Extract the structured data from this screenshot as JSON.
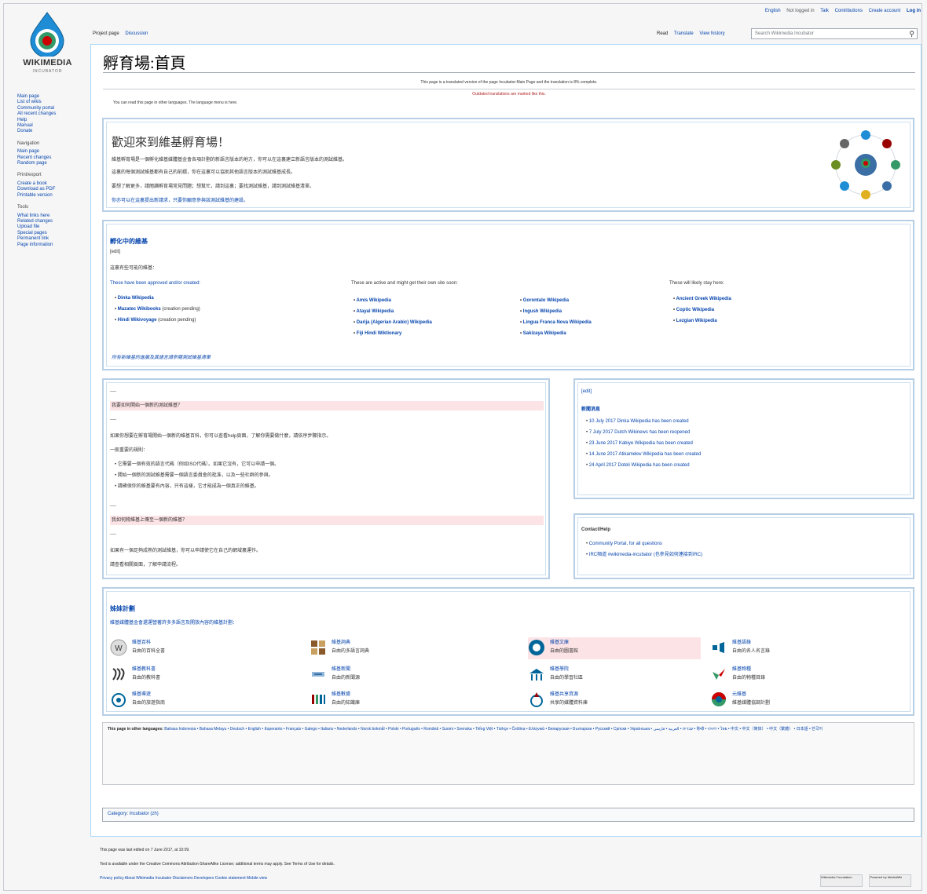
{
  "logo": {
    "wordmark": "WIKIMEDIA",
    "sub": "INCUBATOR"
  },
  "sidebar": {
    "main": [
      "Main page",
      "List of wikis",
      "Community portal",
      "All recent changes",
      "Help",
      "Manual",
      "Donate"
    ],
    "navigation_title": "Navigation",
    "navigation": [
      "Main page",
      "Recent changes",
      "Random page"
    ],
    "print_title": "Print/export",
    "print": [
      "Create a book",
      "Download as PDF",
      "Printable version"
    ],
    "tools_title": "Tools",
    "tools": [
      "What links here",
      "Related changes",
      "Upload file",
      "Special pages",
      "Permanent link",
      "Page information"
    ]
  },
  "personal": {
    "lang": "English",
    "notlogged": "Not logged in",
    "talk": "Talk",
    "contribs": "Contributions",
    "create": "Create account",
    "login": "Log in"
  },
  "tabs": {
    "project": "Project page",
    "discussion": "Discussion",
    "read": "Read",
    "translate": "Translate",
    "history": "View history"
  },
  "search": {
    "placeholder": "Search Wikimedia Incubator"
  },
  "page": {
    "title": "孵育場:首頁",
    "notice1": "This page is a translated version of the page Incubator:Main Page and the translation is 8% complete.",
    "notice2": "Outdated translations are marked like this.",
    "langnote": "You can read this page in other languages. The language menu is here."
  },
  "welcome": {
    "title": "歡迎來到維基孵育場！",
    "lines": [
      "維基孵育場是一個孵化維基媒體基金會各項計劃的新語言版本的地方，你可以在這裏建立新語言版本的測試維基。",
      "這裏的每個測試維基都有自己的前綴，你在這裏可以協助其他語言版本的測試維基成長。",
      "要想了解更多，請閱讀孵育場常見問題；想幫忙，請到這裏；要找測試維基，請到測試維基清單。",
      "你亦可以在這裏提出新請求，只要你願意參與該測試維基的建設。"
    ]
  },
  "incubating": {
    "title": "孵化中的維基",
    "edit": "[edit]",
    "intro": "這裏有些可能的維基：",
    "col1_head": "These have been approved and/or created:",
    "col1": [
      {
        "name": "Dinka Wikipedia",
        "note": ""
      },
      {
        "name": "Mazatec Wikibooks",
        "note": " (creation pending)"
      },
      {
        "name": "Hindi Wikivoyage",
        "note": " (creation pending)"
      }
    ],
    "col2_head": "These are active and might get their own site soon:",
    "col2a": [
      "Amis Wikipedia",
      "Atayal Wikipedia",
      "Darija (Algerian Arabic) Wikipedia",
      "Fiji Hindi Wiktionary"
    ],
    "col2b": [
      "Gorontalo Wikipedia",
      "Ingush Wikipedia",
      "Lingua Franca Nova Wikipedia",
      "Sakizaya Wikipedia"
    ],
    "col3_head": "These will likely stay here:",
    "col3": [
      "Ancient Greek Wikipedia",
      "Coptic Wikipedia",
      "Lezgian Wikipedia"
    ],
    "footer": "所有新維基的進展及其語言請參閱測試維基清單"
  },
  "faq": {
    "small1": "----",
    "q1": "我要如何開始一個新的測試維基？",
    "small2": "----",
    "p1": "如果你想要在孵育場開始一個新的維基百科，你可以查看help頁面，了解你需要做什麼，請依序步驟指示。",
    "p2": "一般重要的規則：",
    "b1": "它需要一個有效的語言代碼（例如ISO代碼）。如果它沒有，它可以申請一個。",
    "b2": "開始一個新的測試維基需要一個語言委員會的批准，以及一些社群的參與。",
    "b3": "請確保你的維基要有內容，只有這樣，它才能成為一個真正的維基。",
    "small3": "----",
    "q2": "我如何將維基上傳至一個新的維基？",
    "small4": "----",
    "p3": "如果有一個足夠成熟的測試維基，你可以申請使它在自己的網域裏運作。",
    "p4": "請查看相關頁面，了解申請流程。"
  },
  "news": {
    "edit": "[edit]",
    "title": "新聞消息",
    "items": [
      {
        "date": "10 July 2017",
        "text": "Dinka Wikipedia has been created"
      },
      {
        "date": "7 July 2017",
        "text": "Dutch Wikinews has been reopened"
      },
      {
        "date": "23 June 2017",
        "text": "Kabiye Wikipedia has been created"
      },
      {
        "date": "14 June 2017",
        "text": "Atikamekw Wikipedia has been created"
      },
      {
        "date": "24 April 2017",
        "text": "Doteli Wikipedia has been created"
      }
    ]
  },
  "contact": {
    "title": "Contact/Help",
    "items": [
      "Community Portal, for all questions",
      "IRC頻道 #wikimedia-incubator (也參見如何連接到IRC)"
    ]
  },
  "projects": {
    "title": "姊妹計劃",
    "intro": "維基媒體基金會還運營著許多多語言及開放內容的維基計劃：",
    "items": [
      {
        "name": "維基百科",
        "desc": "自由的百科全書"
      },
      {
        "name": "維基詞典",
        "desc": "自由的多語言詞典"
      },
      {
        "name": "維基文庫",
        "desc": "自由的圖書館"
      },
      {
        "name": "維基語錄",
        "desc": "自由的名人名言錄"
      },
      {
        "name": "維基教科書",
        "desc": "自由的教科書"
      },
      {
        "name": "維基新聞",
        "desc": "自由的新聞源"
      },
      {
        "name": "維基學院",
        "desc": "自由的學習社區"
      },
      {
        "name": "維基物種",
        "desc": "自由的物種目錄"
      },
      {
        "name": "維基導遊",
        "desc": "自由的旅遊指南"
      },
      {
        "name": "維基數據",
        "desc": "自由的知識庫"
      },
      {
        "name": "維基共享資源",
        "desc": "共享的媒體資料庫"
      },
      {
        "name": "元維基",
        "desc": "維基媒體協調計劃"
      }
    ]
  },
  "languages": {
    "label": "This page in other languages:",
    "list": "Bahasa Indonesia • Bahasa Melayu • Deutsch • English • Esperanto • Français • Galego • Italiano • Nederlands • Norsk bokmål • Polski • Português • Română • Suomi • Svenska • Tiếng Việt • Türkçe • Čeština • Ελληνικά • Беларуская • Български • Русский • Српски • Українська • עברית • العربية • فارسی • हिन्दी • বাংলা • ไทย • 中文 • 中文（简体） • 中文（繁體） • 日本語 • 한국어"
  },
  "category": {
    "label": "Category",
    "value": "Incubator (zh)"
  },
  "footer": {
    "edited": "This page was last edited on 7 June 2017, at 10:09.",
    "license": "Text is available under the Creative Commons Attribution-ShareAlike License; additional terms may apply. See Terms of Use for details.",
    "links": "Privacy policy   About Wikimedia Incubator   Disclaimers   Developers   Cookie statement   Mobile view",
    "badge1": "Wikimedia Foundation",
    "badge2": "Powered by MediaWiki"
  }
}
